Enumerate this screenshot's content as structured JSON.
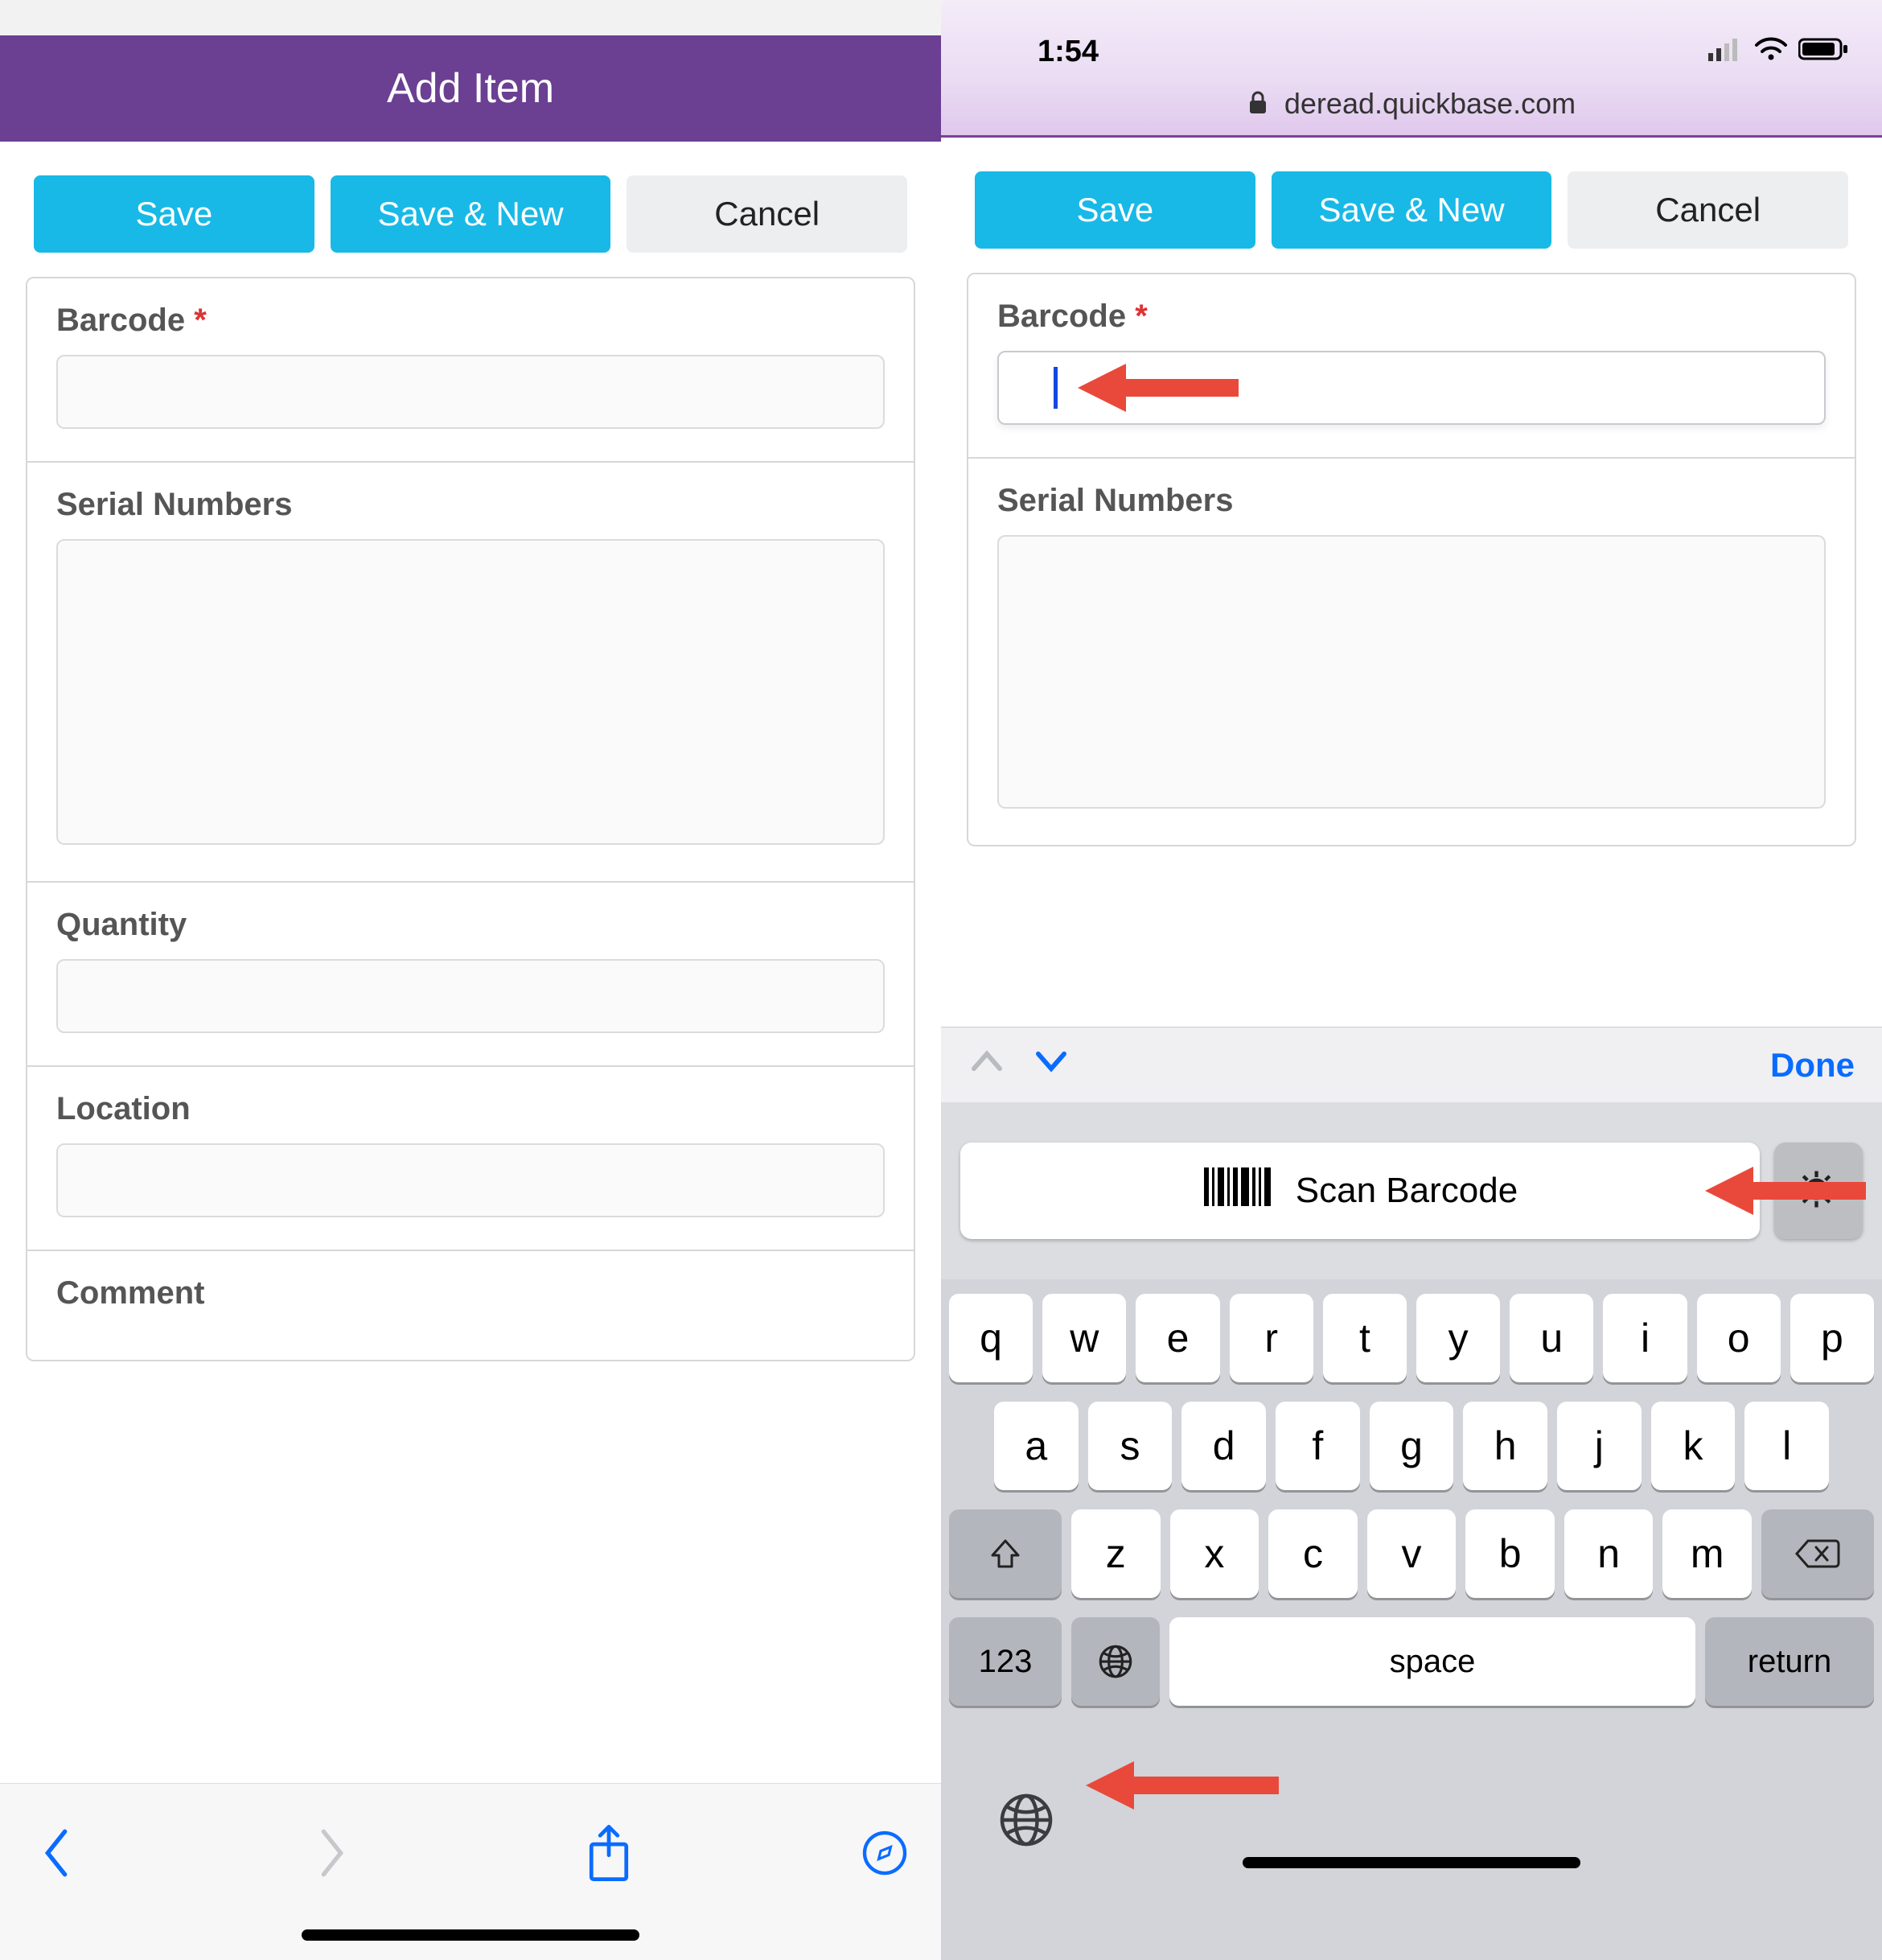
{
  "left": {
    "header_title": "Add Item",
    "buttons": {
      "save": "Save",
      "save_new": "Save & New",
      "cancel": "Cancel"
    },
    "fields": {
      "barcode_label": "Barcode",
      "serial_label": "Serial Numbers",
      "quantity_label": "Quantity",
      "location_label": "Location",
      "comment_label": "Comment",
      "required_mark": "*"
    }
  },
  "right": {
    "status": {
      "time": "1:54"
    },
    "url": "deread.quickbase.com",
    "buttons": {
      "save": "Save",
      "save_new": "Save & New",
      "cancel": "Cancel"
    },
    "fields": {
      "barcode_label": "Barcode",
      "serial_label": "Serial Numbers",
      "required_mark": "*"
    },
    "kb_accessory": {
      "done": "Done"
    },
    "scan": {
      "label": "Scan Barcode"
    },
    "keyboard": {
      "row1": [
        "q",
        "w",
        "e",
        "r",
        "t",
        "y",
        "u",
        "i",
        "o",
        "p"
      ],
      "row2": [
        "a",
        "s",
        "d",
        "f",
        "g",
        "h",
        "j",
        "k",
        "l"
      ],
      "row3": [
        "z",
        "x",
        "c",
        "v",
        "b",
        "n",
        "m"
      ],
      "mode_key": "123",
      "space_key": "space",
      "return_key": "return"
    }
  }
}
